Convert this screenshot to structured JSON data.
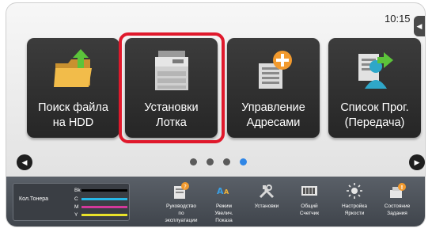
{
  "status": {
    "time": "10:15",
    "side_tab_icon": "collapse-left-icon",
    "side_tab_glyph": "◀"
  },
  "tiles": [
    {
      "label": "Поиск файла\nна HDD",
      "icon": "folder-arrow-icon"
    },
    {
      "label": "Установки\nЛотка",
      "icon": "printer-icon",
      "highlighted": true
    },
    {
      "label": "Управление\nАдресами",
      "icon": "address-book-plus-icon"
    },
    {
      "label": "Список Прог.\n(Передача)",
      "icon": "program-list-icon"
    }
  ],
  "pager": {
    "page_count": 4,
    "active_index": 3,
    "active_color": "#2f86e6",
    "left_glyph": "◀",
    "right_glyph": "▶"
  },
  "status_bar": {
    "toner": {
      "label": "Кол.Тонера",
      "channels": [
        {
          "name": "Bk",
          "color": "#000000",
          "level": 1.0
        },
        {
          "name": "C",
          "color": "#27b7e6",
          "level": 1.0
        },
        {
          "name": "M",
          "color": "#d2399b",
          "level": 1.0
        },
        {
          "name": "Y",
          "color": "#e8e22a",
          "level": 1.0
        }
      ]
    },
    "items": [
      {
        "label": "Руководство\nпо\nэксплуатации",
        "icon": "manual-icon"
      },
      {
        "label": "Режим\nУвелич.\nПоказа",
        "icon": "magnify-text-icon"
      },
      {
        "label": "Установки",
        "icon": "tools-icon"
      },
      {
        "label": "Общий\nСчетчик",
        "icon": "counter-icon"
      },
      {
        "label": "Настройка\nЯркости",
        "icon": "brightness-icon"
      },
      {
        "label": "Состояние\nЗадания",
        "icon": "job-status-icon"
      }
    ]
  },
  "colors": {
    "highlight": "#e0192c",
    "tile_bg": "#2d2d2d"
  }
}
